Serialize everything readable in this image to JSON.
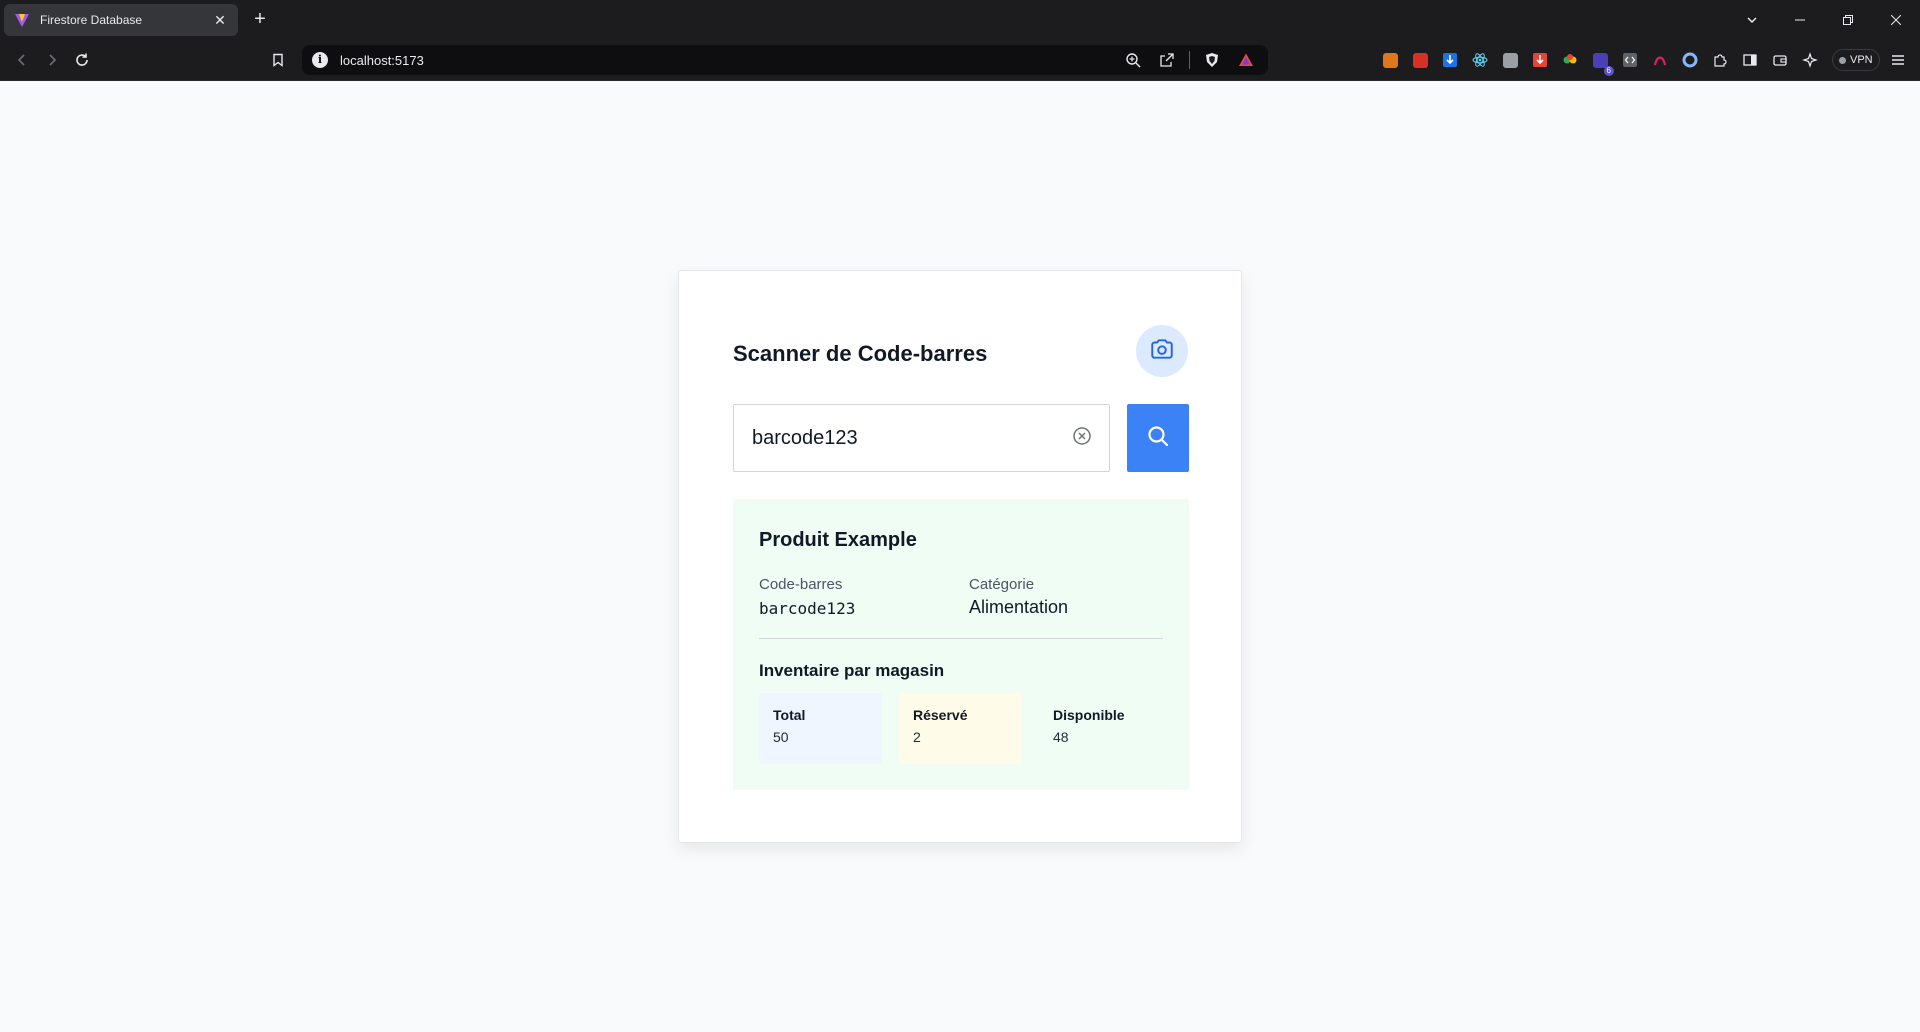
{
  "browser": {
    "tab_title": "Firestore Database",
    "url": "localhost:5173",
    "vpn_label": "VPN",
    "ext_badge": "6",
    "colors": {
      "chrome_bg": "#1c1c1f",
      "tab_bg": "#35363a",
      "url_bg": "#0e0e10"
    }
  },
  "scanner": {
    "title": "Scanner de Code-barres",
    "input_value": "barcode123",
    "colors": {
      "primary": "#3b82f6",
      "camera_bg": "#dbeafe",
      "result_bg": "#f0fdf4"
    }
  },
  "product": {
    "name": "Produit Example",
    "barcode_label": "Code-barres",
    "barcode_value": "barcode123",
    "category_label": "Catégorie",
    "category_value": "Alimentation"
  },
  "inventory": {
    "title": "Inventaire par magasin",
    "stats": [
      {
        "label": "Total",
        "value": "50",
        "bg": "#eff6ff"
      },
      {
        "label": "Réservé",
        "value": "2",
        "bg": "#fefce8"
      },
      {
        "label": "Disponible",
        "value": "48",
        "bg": "#f0fdf4"
      }
    ]
  }
}
